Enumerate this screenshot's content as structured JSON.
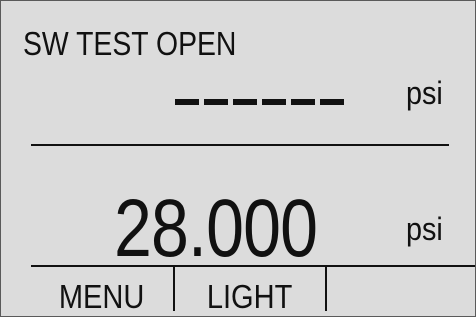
{
  "display": {
    "status_text": "SW TEST OPEN",
    "secondary_unit": "psi",
    "primary_reading": "28.000",
    "primary_unit": "psi"
  },
  "softkeys": [
    {
      "label": "MENU"
    },
    {
      "label": "LIGHT"
    },
    {
      "label": ""
    }
  ],
  "colors": {
    "background": "#dcdcdc",
    "foreground": "#111111",
    "bezel": "#5a5a5a"
  }
}
